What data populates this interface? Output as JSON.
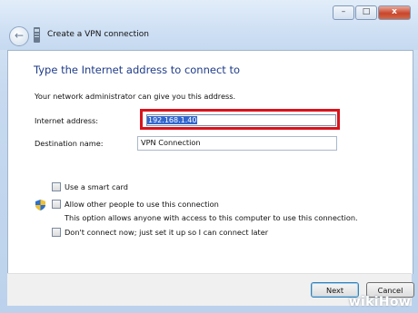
{
  "window": {
    "title": "Create a VPN connection",
    "controls": {
      "minimize": "–",
      "maximize": "□",
      "close": "x"
    }
  },
  "page": {
    "heading": "Type the Internet address to connect to",
    "description": "Your network administrator can give you this address."
  },
  "fields": {
    "internet_address": {
      "label": "Internet address:",
      "value": "192.168.1.40"
    },
    "destination_name": {
      "label": "Destination name:",
      "value": "VPN Connection"
    }
  },
  "options": {
    "smart_card": {
      "label": "Use a smart card",
      "checked": false
    },
    "allow_others": {
      "label": "Allow other people to use this connection",
      "note": "This option allows anyone with access to this computer to use this connection.",
      "checked": false
    },
    "dont_connect": {
      "label": "Don't connect now; just set it up so I can connect later",
      "checked": false
    }
  },
  "buttons": {
    "next": "Next",
    "cancel": "Cancel"
  },
  "watermark": "wikiHow",
  "colors": {
    "highlight_border": "#d9131c",
    "heading": "#1f3c8a",
    "selection": "#3366cc"
  },
  "icons": {
    "back": "back-arrow-icon",
    "wizard": "vpn-wizard-icon",
    "shield": "uac-shield-icon"
  }
}
